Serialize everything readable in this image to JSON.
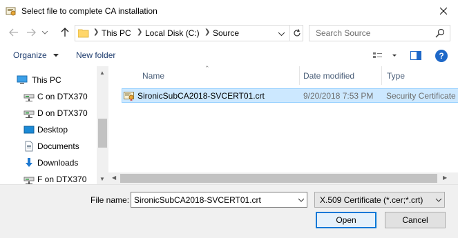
{
  "window": {
    "title": "Select file to complete CA installation",
    "close_icon": "close-icon"
  },
  "address_bar": {
    "breadcrumbs": [
      "This PC",
      "Local Disk (C:)",
      "Source"
    ],
    "search_placeholder": "Search Source"
  },
  "toolbar": {
    "organize_label": "Organize",
    "new_folder_label": "New folder"
  },
  "nav_pane": {
    "items": [
      {
        "label": "This PC",
        "icon": "pc-icon"
      },
      {
        "label": "C on DTX370",
        "icon": "network-drive-icon"
      },
      {
        "label": "D on DTX370",
        "icon": "network-drive-icon"
      },
      {
        "label": "Desktop",
        "icon": "desktop-icon"
      },
      {
        "label": "Documents",
        "icon": "documents-icon"
      },
      {
        "label": "Downloads",
        "icon": "downloads-icon"
      },
      {
        "label": "F on DTX370",
        "icon": "network-drive-icon"
      }
    ]
  },
  "file_list": {
    "columns": [
      "Name",
      "Date modified",
      "Type"
    ],
    "rows": [
      {
        "name": "SironicSubCA2018-SVCERT01.crt",
        "date": "9/20/2018 7:53 PM",
        "type": "Security Certificate",
        "selected": true
      }
    ]
  },
  "bottom": {
    "filename_label": "File name:",
    "filename_value": "SironicSubCA2018-SVCERT01.crt",
    "filetype_value": "X.509 Certificate (*.cer;*.crt)",
    "open_label": "Open",
    "cancel_label": "Cancel"
  },
  "colors": {
    "selection_bg": "#cce8ff",
    "selection_border": "#99d1ff",
    "accent": "#0078d7",
    "link_text": "#1e3c6e"
  }
}
